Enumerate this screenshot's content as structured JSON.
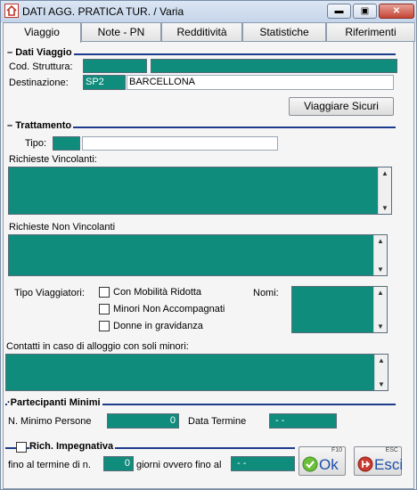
{
  "window": {
    "title": "DATI AGG. PRATICA TUR. / Varia",
    "min_glyph": "▬",
    "max_glyph": "▣",
    "close_glyph": "✕"
  },
  "tabs": [
    {
      "label": "Viaggio"
    },
    {
      "label": "Note - PN"
    },
    {
      "label": "Redditività"
    },
    {
      "label": "Statistiche"
    },
    {
      "label": "Riferimenti"
    }
  ],
  "dati_viaggio": {
    "title": "Dati Viaggio",
    "cod_struttura_label": "Cod. Struttura:",
    "destinazione_label": "Destinazione:",
    "dest_code": "SP2",
    "dest_name": "BARCELLONA",
    "viaggiare_sicuri_label": "Viaggiare Sicuri"
  },
  "trattamento": {
    "title": "Trattamento",
    "tipo_label": "Tipo:",
    "richieste_vincolanti_label": "Richieste Vincolanti:",
    "richieste_non_vincolanti_label": "Richieste Non Vincolanti",
    "tipo_viaggiatori_label": "Tipo Viaggiatori:",
    "checkboxes": [
      {
        "label": "Con Mobilità Ridotta"
      },
      {
        "label": "Minori Non Accompagnati"
      },
      {
        "label": "Donne in gravidanza"
      }
    ],
    "nomi_label": "Nomi:",
    "contatti_label": "Contatti in caso di alloggio con soli minori:"
  },
  "partecipanti": {
    "title": "Partecipanti Minimi",
    "n_minimo_label": "N. Minimo Persone",
    "n_minimo_value": "0",
    "data_termine_label": "Data Termine",
    "data_termine_value": "- -"
  },
  "rich_impegnativa": {
    "title": "Rich. Impegnativa",
    "fino_label": "fino al termine di n.",
    "giorni_value": "0",
    "giorni_label": "giorni ovvero fino al",
    "data_value": "- -"
  },
  "actions": {
    "ok_key": "F10",
    "ok_label": "Ok",
    "esc_key": "ESC",
    "esc_label": "Esci"
  },
  "colors": {
    "field_teal": "#0f8c7c",
    "section_line": "#1d3b8c"
  }
}
